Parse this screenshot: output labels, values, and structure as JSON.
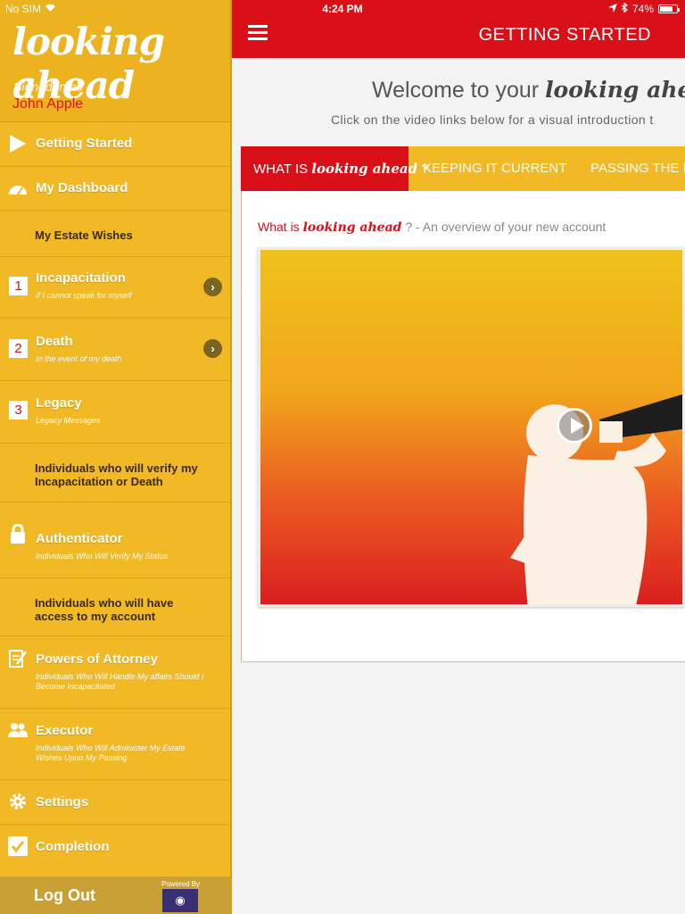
{
  "status_bar": {
    "carrier": "No SIM",
    "time": "4:24 PM",
    "battery": "74%"
  },
  "sidebar": {
    "logo": "looking ahead",
    "signed_in_label": "Signed In as",
    "user_name": "John Apple",
    "items": [
      {
        "title": "Getting Started"
      },
      {
        "title": "My Dashboard"
      },
      {
        "title": "My Estate Wishes"
      },
      {
        "number": "1",
        "title": "Incapacitation",
        "subtitle": "If I cannot speak for myself"
      },
      {
        "number": "2",
        "title": "Death",
        "subtitle": "In the event of my death"
      },
      {
        "number": "3",
        "title": "Legacy",
        "subtitle": "Legacy Messages"
      },
      {
        "title": "Individuals who will verify my Incapacitation or Death"
      },
      {
        "title": "Authenticator",
        "subtitle": "Individuals Who Will Verify My Status"
      },
      {
        "title": "Individuals who will have access to my account"
      },
      {
        "title": "Powers of Attorney",
        "subtitle": "Individuals Who Will Handle My affairs Should I Become Incapacitated"
      },
      {
        "title": "Executor",
        "subtitle": "Individuals Who Will Administer My Estate Wishes Upon My Passing"
      },
      {
        "title": "Settings"
      },
      {
        "title": "Completion"
      }
    ],
    "logout": "Log Out",
    "powered_by": "Powered By"
  },
  "header": {
    "title": "GETTING STARTED"
  },
  "main": {
    "welcome_prefix": "Welcome to your",
    "welcome_brand": "looking ahead",
    "instructions": "Click on the video links below for a visual introduction t",
    "tabs": [
      {
        "prefix": "WHAT IS",
        "brand": "looking ahead",
        "suffix": "?"
      },
      {
        "label": "KEEPING IT CURRENT"
      },
      {
        "label": "PASSING THE B"
      }
    ],
    "video_caption_prefix": "What is",
    "video_caption_brand": "looking ahead",
    "video_caption_suffix": "? - An overview of your new account"
  },
  "colors": {
    "red": "#da1019",
    "yellow": "#f2b927",
    "dark_text": "#3a2a05"
  }
}
